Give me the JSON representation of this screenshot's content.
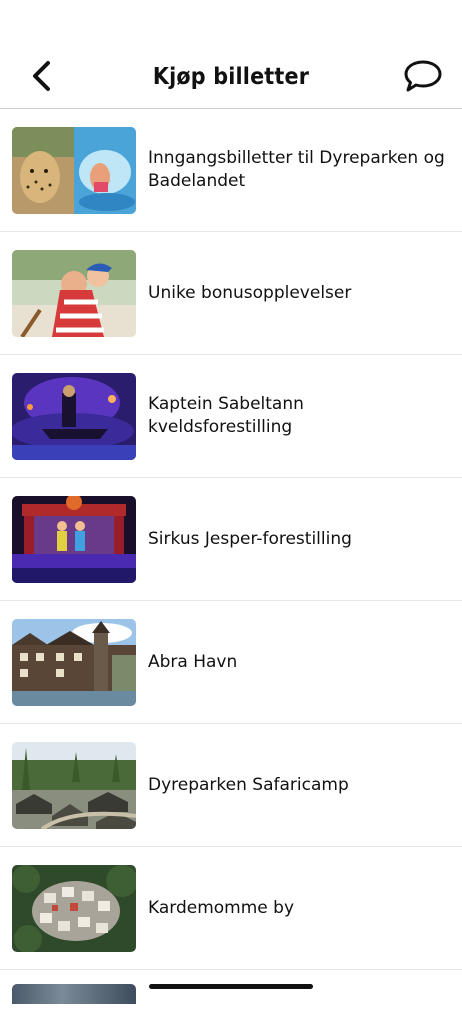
{
  "header": {
    "title": "Kjøp billetter",
    "back_icon": "chevron-left-icon",
    "chat_icon": "speech-bubble-icon"
  },
  "items": [
    {
      "label": "Inngangsbilletter til Dyreparken og Badelandet"
    },
    {
      "label": "Unike bonusopplevelser"
    },
    {
      "label": "Kaptein Sabeltann kveldsforestilling"
    },
    {
      "label": "Sirkus Jesper-forestilling"
    },
    {
      "label": "Abra Havn"
    },
    {
      "label": "Dyreparken Safaricamp"
    },
    {
      "label": "Kardemomme by"
    }
  ],
  "colors": {
    "text": "#111111",
    "divider": "#e8e8e8",
    "header_divider": "#cfcfcf",
    "background": "#ffffff"
  }
}
